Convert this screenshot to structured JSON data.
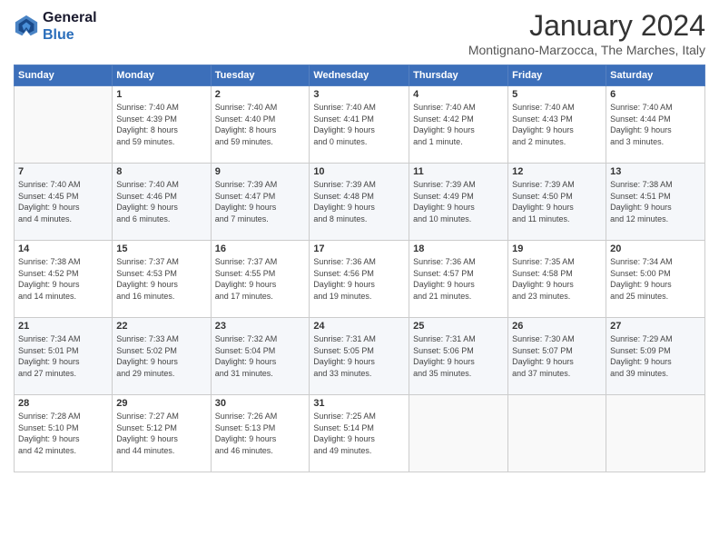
{
  "logo": {
    "line1": "General",
    "line2": "Blue"
  },
  "header": {
    "month": "January 2024",
    "location": "Montignano-Marzocca, The Marches, Italy"
  },
  "weekdays": [
    "Sunday",
    "Monday",
    "Tuesday",
    "Wednesday",
    "Thursday",
    "Friday",
    "Saturday"
  ],
  "weeks": [
    [
      {
        "day": "",
        "info": ""
      },
      {
        "day": "1",
        "info": "Sunrise: 7:40 AM\nSunset: 4:39 PM\nDaylight: 8 hours\nand 59 minutes."
      },
      {
        "day": "2",
        "info": "Sunrise: 7:40 AM\nSunset: 4:40 PM\nDaylight: 8 hours\nand 59 minutes."
      },
      {
        "day": "3",
        "info": "Sunrise: 7:40 AM\nSunset: 4:41 PM\nDaylight: 9 hours\nand 0 minutes."
      },
      {
        "day": "4",
        "info": "Sunrise: 7:40 AM\nSunset: 4:42 PM\nDaylight: 9 hours\nand 1 minute."
      },
      {
        "day": "5",
        "info": "Sunrise: 7:40 AM\nSunset: 4:43 PM\nDaylight: 9 hours\nand 2 minutes."
      },
      {
        "day": "6",
        "info": "Sunrise: 7:40 AM\nSunset: 4:44 PM\nDaylight: 9 hours\nand 3 minutes."
      }
    ],
    [
      {
        "day": "7",
        "info": "Sunrise: 7:40 AM\nSunset: 4:45 PM\nDaylight: 9 hours\nand 4 minutes."
      },
      {
        "day": "8",
        "info": "Sunrise: 7:40 AM\nSunset: 4:46 PM\nDaylight: 9 hours\nand 6 minutes."
      },
      {
        "day": "9",
        "info": "Sunrise: 7:39 AM\nSunset: 4:47 PM\nDaylight: 9 hours\nand 7 minutes."
      },
      {
        "day": "10",
        "info": "Sunrise: 7:39 AM\nSunset: 4:48 PM\nDaylight: 9 hours\nand 8 minutes."
      },
      {
        "day": "11",
        "info": "Sunrise: 7:39 AM\nSunset: 4:49 PM\nDaylight: 9 hours\nand 10 minutes."
      },
      {
        "day": "12",
        "info": "Sunrise: 7:39 AM\nSunset: 4:50 PM\nDaylight: 9 hours\nand 11 minutes."
      },
      {
        "day": "13",
        "info": "Sunrise: 7:38 AM\nSunset: 4:51 PM\nDaylight: 9 hours\nand 12 minutes."
      }
    ],
    [
      {
        "day": "14",
        "info": "Sunrise: 7:38 AM\nSunset: 4:52 PM\nDaylight: 9 hours\nand 14 minutes."
      },
      {
        "day": "15",
        "info": "Sunrise: 7:37 AM\nSunset: 4:53 PM\nDaylight: 9 hours\nand 16 minutes."
      },
      {
        "day": "16",
        "info": "Sunrise: 7:37 AM\nSunset: 4:55 PM\nDaylight: 9 hours\nand 17 minutes."
      },
      {
        "day": "17",
        "info": "Sunrise: 7:36 AM\nSunset: 4:56 PM\nDaylight: 9 hours\nand 19 minutes."
      },
      {
        "day": "18",
        "info": "Sunrise: 7:36 AM\nSunset: 4:57 PM\nDaylight: 9 hours\nand 21 minutes."
      },
      {
        "day": "19",
        "info": "Sunrise: 7:35 AM\nSunset: 4:58 PM\nDaylight: 9 hours\nand 23 minutes."
      },
      {
        "day": "20",
        "info": "Sunrise: 7:34 AM\nSunset: 5:00 PM\nDaylight: 9 hours\nand 25 minutes."
      }
    ],
    [
      {
        "day": "21",
        "info": "Sunrise: 7:34 AM\nSunset: 5:01 PM\nDaylight: 9 hours\nand 27 minutes."
      },
      {
        "day": "22",
        "info": "Sunrise: 7:33 AM\nSunset: 5:02 PM\nDaylight: 9 hours\nand 29 minutes."
      },
      {
        "day": "23",
        "info": "Sunrise: 7:32 AM\nSunset: 5:04 PM\nDaylight: 9 hours\nand 31 minutes."
      },
      {
        "day": "24",
        "info": "Sunrise: 7:31 AM\nSunset: 5:05 PM\nDaylight: 9 hours\nand 33 minutes."
      },
      {
        "day": "25",
        "info": "Sunrise: 7:31 AM\nSunset: 5:06 PM\nDaylight: 9 hours\nand 35 minutes."
      },
      {
        "day": "26",
        "info": "Sunrise: 7:30 AM\nSunset: 5:07 PM\nDaylight: 9 hours\nand 37 minutes."
      },
      {
        "day": "27",
        "info": "Sunrise: 7:29 AM\nSunset: 5:09 PM\nDaylight: 9 hours\nand 39 minutes."
      }
    ],
    [
      {
        "day": "28",
        "info": "Sunrise: 7:28 AM\nSunset: 5:10 PM\nDaylight: 9 hours\nand 42 minutes."
      },
      {
        "day": "29",
        "info": "Sunrise: 7:27 AM\nSunset: 5:12 PM\nDaylight: 9 hours\nand 44 minutes."
      },
      {
        "day": "30",
        "info": "Sunrise: 7:26 AM\nSunset: 5:13 PM\nDaylight: 9 hours\nand 46 minutes."
      },
      {
        "day": "31",
        "info": "Sunrise: 7:25 AM\nSunset: 5:14 PM\nDaylight: 9 hours\nand 49 minutes."
      },
      {
        "day": "",
        "info": ""
      },
      {
        "day": "",
        "info": ""
      },
      {
        "day": "",
        "info": ""
      }
    ]
  ]
}
